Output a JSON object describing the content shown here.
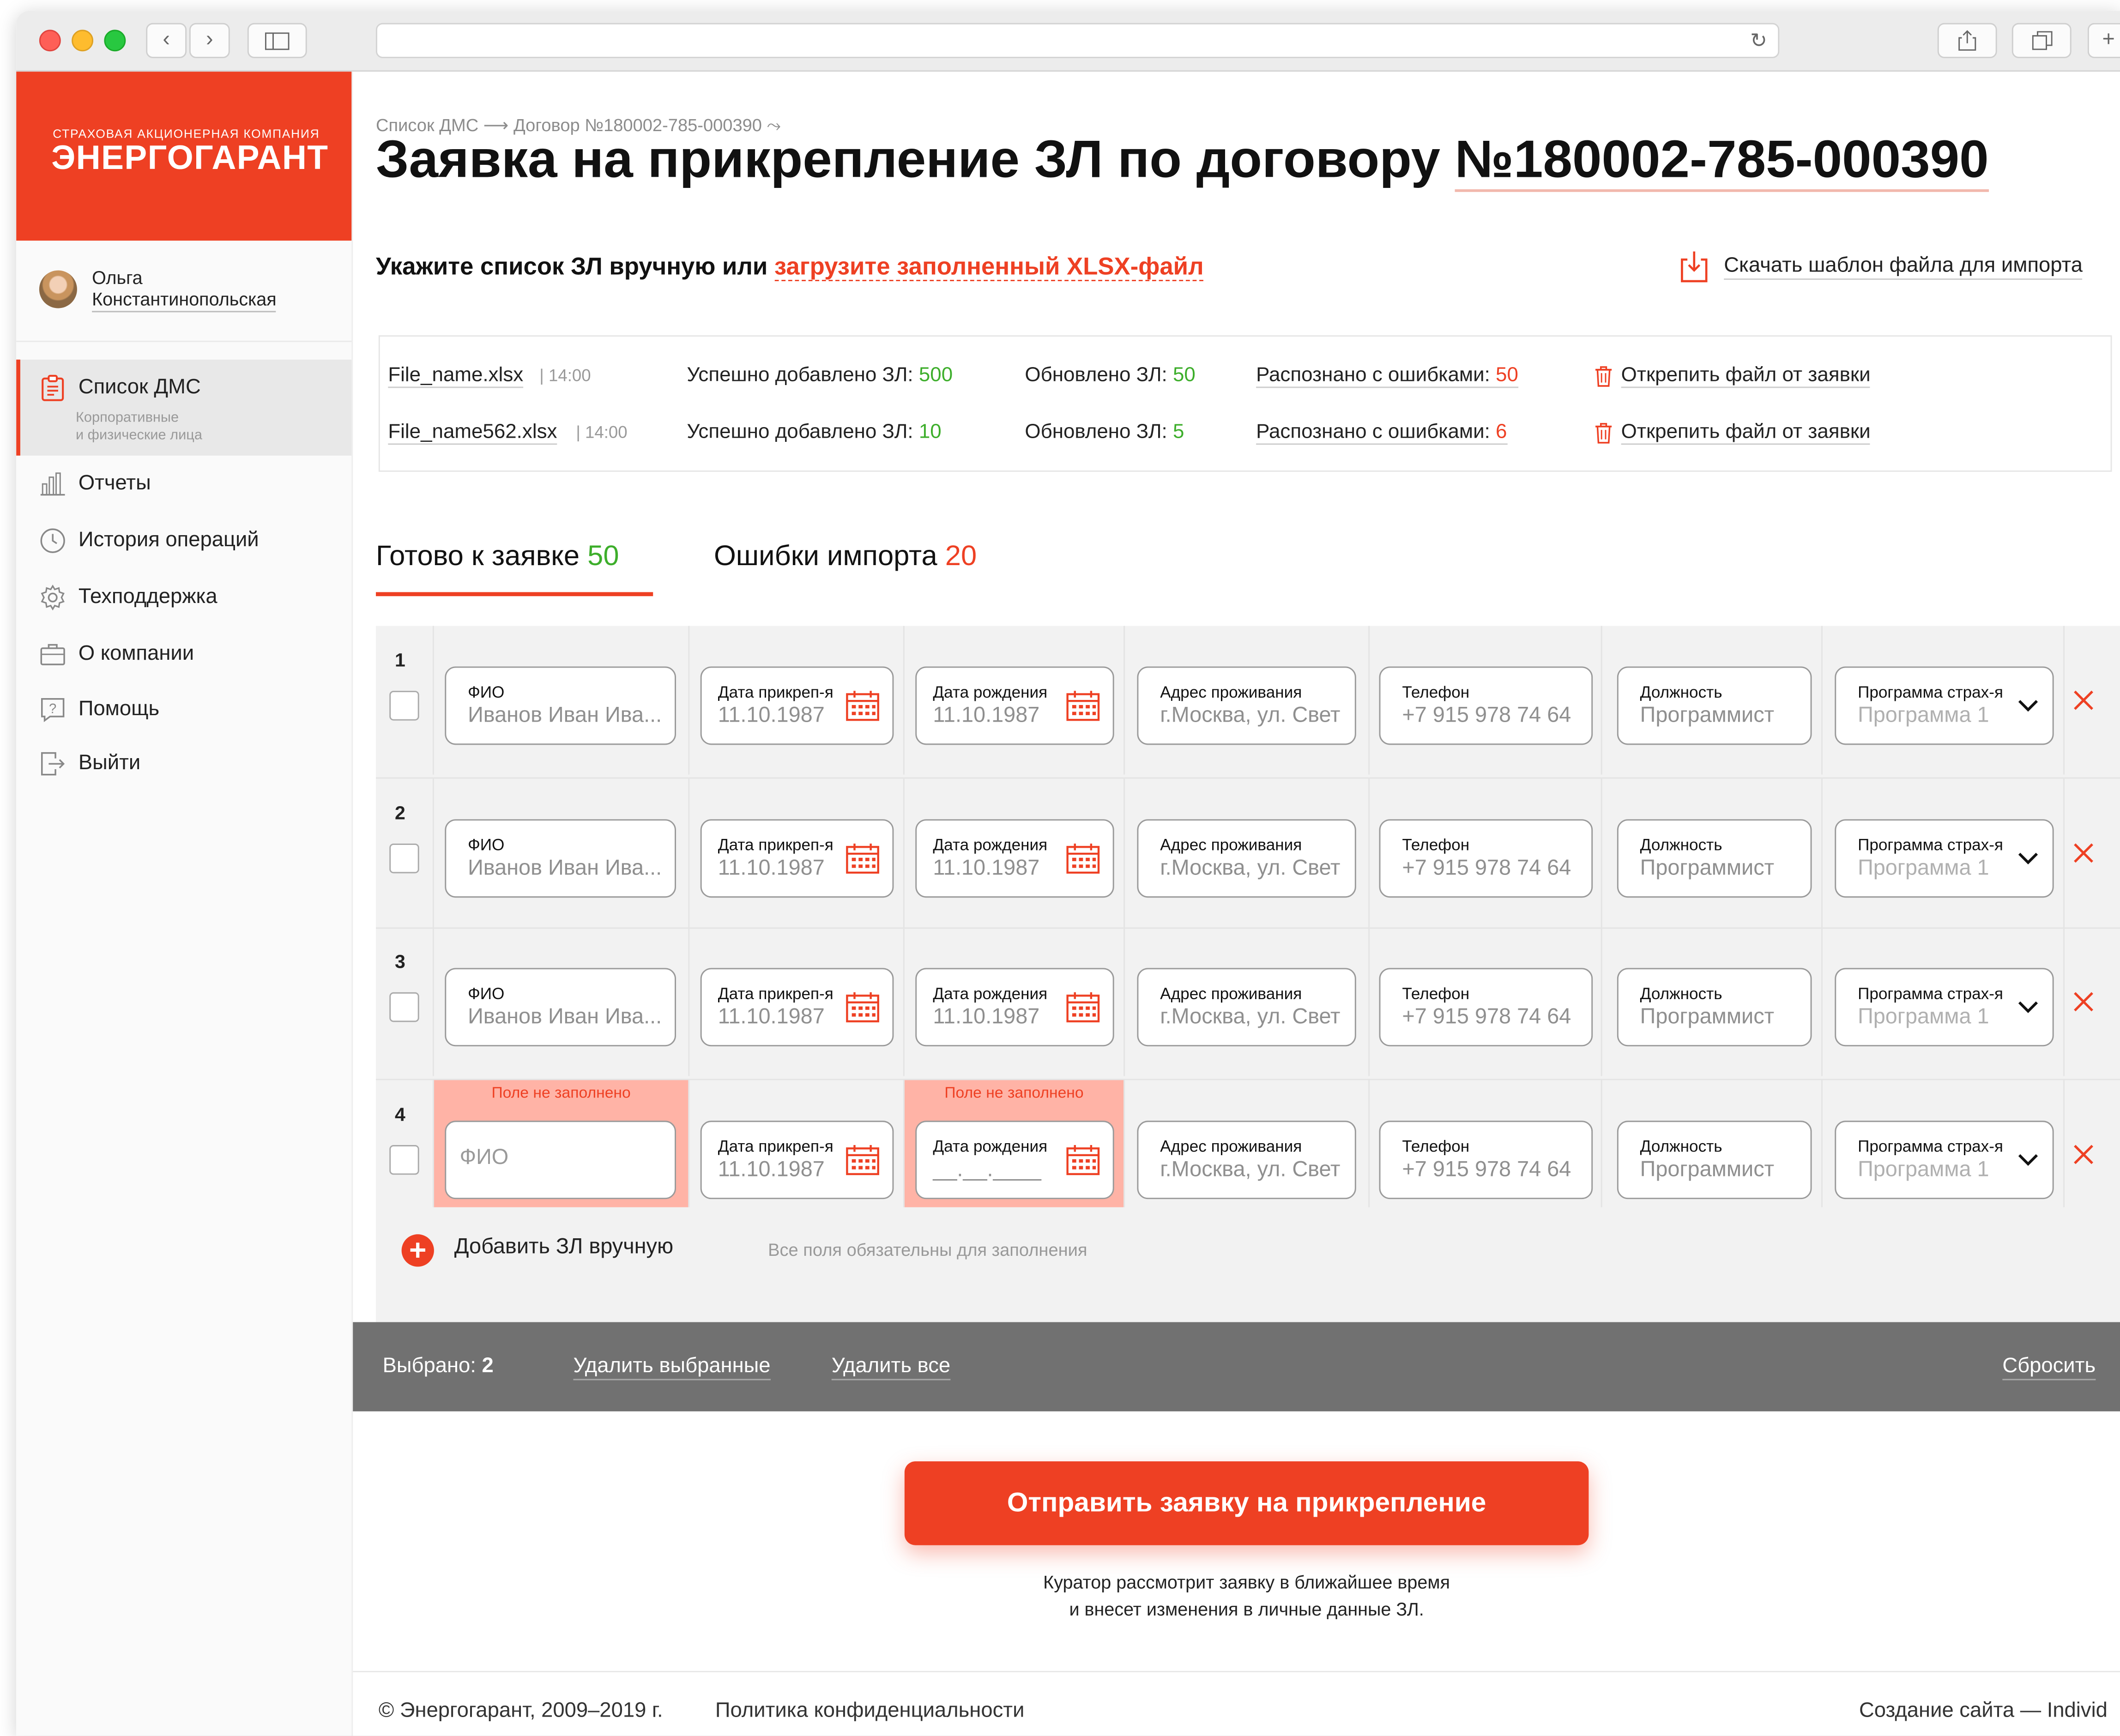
{
  "sidebar": {
    "logo": {
      "top": "Страховая акционерная компания",
      "main": "ЭНЕРГОГАРАНТ"
    },
    "user": {
      "first": "Ольга",
      "last": "Константинопольская"
    },
    "active": {
      "label": "Список ДМС",
      "sub1": "Корпоративные",
      "sub2": "и физические лица"
    },
    "items": [
      {
        "label": "Отчеты",
        "icon": "bar-chart-icon"
      },
      {
        "label": "История операций",
        "icon": "clock-icon"
      },
      {
        "label": "Техподдержка",
        "icon": "gear-icon"
      },
      {
        "label": "О компании",
        "icon": "briefcase-icon"
      },
      {
        "label": "Помощь",
        "icon": "question-icon"
      },
      {
        "label": "Выйти",
        "icon": "logout-icon"
      }
    ]
  },
  "main": {
    "breadcrumb": {
      "b1": "Список ДМС",
      "b2": "Договор №180002-785-000390"
    },
    "title": {
      "prefix": "Заявка на прикрепление ЗЛ по договору ",
      "number": "№180002-785-000390"
    },
    "subtitle": {
      "text": "Укажите список ЗЛ вручную или ",
      "link": "загрузите заполненный XLSX-файл"
    },
    "download_label": "Скачать шаблон файла для импорта",
    "files": [
      {
        "name": "File_name.xlsx",
        "time": "14:00",
        "added_label": "Успешно добавлено ЗЛ:",
        "added": "500",
        "updated_label": "Обновлено ЗЛ:",
        "updated": "50",
        "errors_label": "Распознано с ошибками:",
        "errors": "50",
        "detach": "Открепить файл от заявки"
      },
      {
        "name": "File_name562.xlsx",
        "time": "14:00",
        "added_label": "Успешно добавлено ЗЛ:",
        "added": "10",
        "updated_label": "Обновлено ЗЛ:",
        "updated": "5",
        "errors_label": "Распознано с ошибками:",
        "errors": "6",
        "detach": "Открепить файл от заявки"
      }
    ],
    "tabs": [
      {
        "label": "Готово к заявке",
        "count": "50"
      },
      {
        "label": "Ошибки импорта",
        "count": "20"
      }
    ],
    "labels": {
      "fio": "ФИО",
      "attach_date": "Дата прикреп-я",
      "birth_date": "Дата рождения",
      "address": "Адрес проживания",
      "phone": "Телефон",
      "position": "Должность",
      "program": "Программа страх-я",
      "error": "Поле не заполнено",
      "date_mask": "__.__.____"
    },
    "rows": [
      {
        "num": "1",
        "fio": "Иванов Иван Ива...",
        "attach": "11.10.1987",
        "birth": "11.10.1987",
        "address": "г.Москва, ул. Свет",
        "phone": "+7 915 978 74 64",
        "position": "Программист",
        "program": "Программа 1"
      },
      {
        "num": "2",
        "fio": "Иванов Иван Ива...",
        "attach": "11.10.1987",
        "birth": "11.10.1987",
        "address": "г.Москва, ул. Свет",
        "phone": "+7 915 978 74 64",
        "position": "Программист",
        "program": "Программа 1"
      },
      {
        "num": "3",
        "fio": "Иванов Иван Ива...",
        "attach": "11.10.1987",
        "birth": "11.10.1987",
        "address": "г.Москва, ул. Свет",
        "phone": "+7 915 978 74 64",
        "position": "Программист",
        "program": "Программа 1"
      },
      {
        "num": "4",
        "fio": "",
        "attach": "11.10.1987",
        "birth": "",
        "address": "г.Москва, ул. Свет",
        "phone": "+7 915 978 74 64",
        "position": "Программист",
        "program": "Программа 1"
      }
    ],
    "add_label": "Добавить ЗЛ вручную",
    "add_note": "Все поля обязательны для заполнения",
    "bar": {
      "selected_label": "Выбрано:",
      "selected_count": "2",
      "delete_selected": "Удалить выбранные",
      "delete_all": "Удалить все",
      "reset": "Сбросить"
    },
    "submit": "Отправить заявку на прикрепление",
    "note1": "Куратор рассмотрит заявку в ближайшее время",
    "note2": "и внесет изменения в личные данные ЗЛ.",
    "footer": {
      "copyright": "© Энергогарант, 2009–2019 г.",
      "privacy": "Политика конфиденциальности",
      "credit": "Создание сайта — Individ"
    }
  },
  "colors": {
    "accent": "#ee4023",
    "success": "#3dae2b",
    "bar": "#717171",
    "error_bg": "#ffb3a6"
  }
}
